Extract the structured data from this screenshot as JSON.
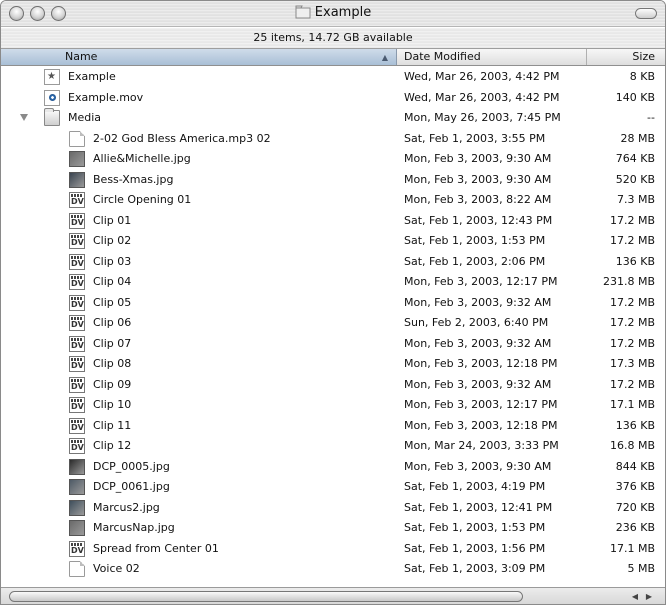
{
  "window": {
    "title": "Example",
    "status": "25 items, 14.72 GB available"
  },
  "columns": {
    "name": "Name",
    "date": "Date Modified",
    "size": "Size"
  },
  "rows": [
    {
      "name": "Example",
      "date": "Wed, Mar 26, 2003, 4:42 PM",
      "size": "8 KB",
      "icon": "example-file-icon"
    },
    {
      "name": "Example.mov",
      "date": "Wed, Mar 26, 2003, 4:42 PM",
      "size": "140 KB",
      "icon": "movie-file-icon"
    },
    {
      "name": "Media",
      "date": "Mon, May 26, 2003, 7:45 PM",
      "size": "--",
      "icon": "folder-icon"
    },
    {
      "name": "2-02 God Bless America.mp3 02",
      "date": "Sat, Feb 1, 2003, 3:55 PM",
      "size": "28 MB",
      "icon": "document-icon"
    },
    {
      "name": "Allie&Michelle.jpg",
      "date": "Mon, Feb 3, 2003, 9:30 AM",
      "size": "764 KB",
      "icon": "photo-thumbnail-icon"
    },
    {
      "name": "Bess-Xmas.jpg",
      "date": "Mon, Feb 3, 2003, 9:30 AM",
      "size": "520 KB",
      "icon": "photo-thumbnail-icon"
    },
    {
      "name": "Circle Opening 01",
      "date": "Mon, Feb 3, 2003, 8:22 AM",
      "size": "7.3 MB",
      "icon": "dv-file-icon"
    },
    {
      "name": "Clip 01",
      "date": "Sat, Feb 1, 2003, 12:43 PM",
      "size": "17.2 MB",
      "icon": "dv-file-icon"
    },
    {
      "name": "Clip 02",
      "date": "Sat, Feb 1, 2003, 1:53 PM",
      "size": "17.2 MB",
      "icon": "dv-file-icon"
    },
    {
      "name": "Clip 03",
      "date": "Sat, Feb 1, 2003, 2:06 PM",
      "size": "136 KB",
      "icon": "dv-file-icon"
    },
    {
      "name": "Clip 04",
      "date": "Mon, Feb 3, 2003, 12:17 PM",
      "size": "231.8 MB",
      "icon": "dv-file-icon"
    },
    {
      "name": "Clip 05",
      "date": "Mon, Feb 3, 2003, 9:32 AM",
      "size": "17.2 MB",
      "icon": "dv-file-icon"
    },
    {
      "name": "Clip 06",
      "date": "Sun, Feb 2, 2003, 6:40 PM",
      "size": "17.2 MB",
      "icon": "dv-file-icon"
    },
    {
      "name": "Clip 07",
      "date": "Mon, Feb 3, 2003, 9:32 AM",
      "size": "17.2 MB",
      "icon": "dv-file-icon"
    },
    {
      "name": "Clip 08",
      "date": "Mon, Feb 3, 2003, 12:18 PM",
      "size": "17.3 MB",
      "icon": "dv-file-icon"
    },
    {
      "name": "Clip 09",
      "date": "Mon, Feb 3, 2003, 9:32 AM",
      "size": "17.2 MB",
      "icon": "dv-file-icon"
    },
    {
      "name": "Clip 10",
      "date": "Mon, Feb 3, 2003, 12:17 PM",
      "size": "17.1 MB",
      "icon": "dv-file-icon"
    },
    {
      "name": "Clip 11",
      "date": "Mon, Feb 3, 2003, 12:18 PM",
      "size": "136 KB",
      "icon": "dv-file-icon"
    },
    {
      "name": "Clip 12",
      "date": "Mon, Mar 24, 2003, 3:33 PM",
      "size": "16.8 MB",
      "icon": "dv-file-icon"
    },
    {
      "name": "DCP_0005.jpg",
      "date": "Mon, Feb 3, 2003, 9:30 AM",
      "size": "844 KB",
      "icon": "photo-thumbnail-icon"
    },
    {
      "name": "DCP_0061.jpg",
      "date": "Sat, Feb 1, 2003, 4:19 PM",
      "size": "376 KB",
      "icon": "photo-thumbnail-icon"
    },
    {
      "name": "Marcus2.jpg",
      "date": "Sat, Feb 1, 2003, 12:41 PM",
      "size": "720 KB",
      "icon": "photo-thumbnail-icon"
    },
    {
      "name": "MarcusNap.jpg",
      "date": "Sat, Feb 1, 2003, 1:53 PM",
      "size": "236 KB",
      "icon": "photo-thumbnail-icon"
    },
    {
      "name": "Spread from Center 01",
      "date": "Sat, Feb 1, 2003, 1:56 PM",
      "size": "17.1 MB",
      "icon": "dv-file-icon"
    },
    {
      "name": "Voice 02",
      "date": "Sat, Feb 1, 2003, 3:09 PM",
      "size": "5 MB",
      "icon": "document-icon"
    }
  ]
}
